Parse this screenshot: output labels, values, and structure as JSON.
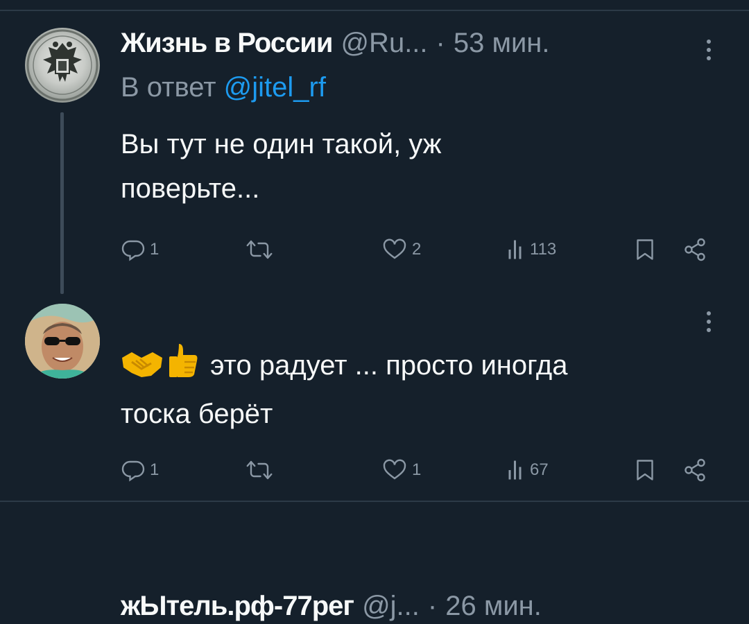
{
  "tweets": [
    {
      "display_name": "Жизнь в России",
      "handle": "@Ru...",
      "separator": "·",
      "time": "53 мин.",
      "reply_prefix": "В ответ",
      "reply_mention": "@jitel_rf",
      "text_line1": "Вы тут не один такой, уж",
      "text_line2": "поверьте...",
      "replies": "1",
      "retweets": "",
      "likes": "2",
      "views": "113"
    },
    {
      "display_name": "жЫтель.рф-77рег",
      "handle": "@j...",
      "separator": "·",
      "time": "26 мин.",
      "emojis": [
        "handshake-emoji",
        "thumbs-up-emoji"
      ],
      "text_line1": "это радует ... просто иногда",
      "text_line2": "тоска берёт",
      "replies": "1",
      "retweets": "",
      "likes": "1",
      "views": "67"
    }
  ],
  "colors": {
    "background": "#15202b",
    "primary_text": "#f7f9f9",
    "secondary_text": "#8b98a5",
    "accent": "#1d9bf0",
    "divider": "#2c3a47"
  },
  "icons": [
    "reply-icon",
    "retweet-icon",
    "like-icon",
    "views-icon",
    "bookmark-icon",
    "share-icon",
    "more-icon"
  ]
}
